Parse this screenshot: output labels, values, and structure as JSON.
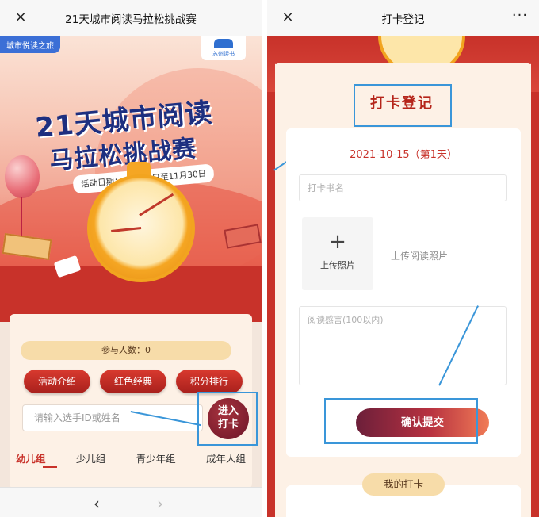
{
  "left_screen": {
    "nav": {
      "close_icon": "×",
      "title": "21天城市阅读马拉松挑战赛"
    },
    "hero": {
      "tag": "城市悦读之旅",
      "logo_text": "苏州读书",
      "title_line1": "21天城市阅读",
      "title_line2": "马拉松挑战赛",
      "date_label": "活动日期：10月20日至11月30日"
    },
    "participants_label": "参与人数：0",
    "buttons": [
      "活动介绍",
      "红色经典",
      "积分排行"
    ],
    "search": {
      "placeholder": "请输入选手ID或姓名"
    },
    "enter_button": {
      "line1": "进入",
      "line2": "打卡"
    },
    "tabs": [
      "幼儿组",
      "少儿组",
      "青少年组",
      "成年人组"
    ],
    "active_tab_index": 0,
    "bottom_bar": {
      "back_icon": "‹",
      "forward_icon": "›"
    }
  },
  "right_screen": {
    "nav": {
      "close_icon": "×",
      "title": "打卡登记",
      "more_icon": "···"
    },
    "heading": "打卡登记",
    "date": "2021-10-15（第1天）",
    "book_field": {
      "placeholder": "打卡书名"
    },
    "upload": {
      "plus_icon": "+",
      "label": "上传照片",
      "hint": "上传阅读照片"
    },
    "feel_field": {
      "placeholder": "阅读感言(100以内)"
    },
    "submit_label": "确认提交",
    "my_card_label": "我的打卡"
  },
  "colors": {
    "primary_red": "#c8322a",
    "annotation_blue": "#3a96d9",
    "cream": "#fdf1e6",
    "gold": "#f7dca9"
  },
  "icons": {
    "close": "close-icon",
    "more": "more-icon",
    "back": "chevron-left-icon",
    "forward": "chevron-right-icon",
    "plus": "plus-icon"
  }
}
